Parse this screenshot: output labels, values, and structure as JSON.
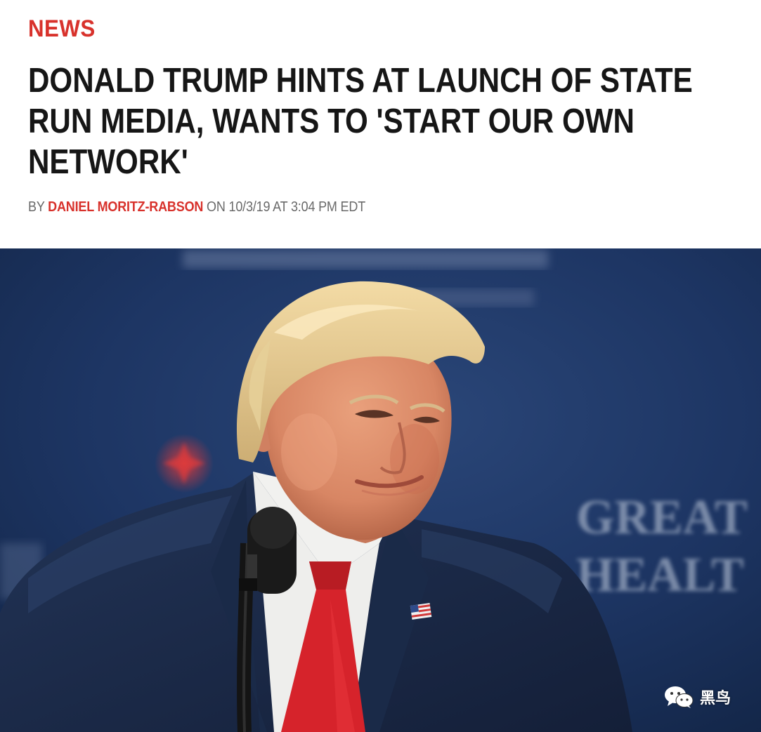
{
  "article": {
    "section": "NEWS",
    "headline_lines": [
      "DONALD TRUMP HINTS AT LAUNCH OF STATE",
      "RUN MEDIA, WANTS TO 'START OUR OWN",
      "NETWORK'"
    ],
    "byline": {
      "prefix": "BY",
      "author": "DANIEL MORITZ-RABSON",
      "middle": "ON",
      "date": "10/3/19",
      "at": "AT",
      "time": "3:04 PM EDT"
    }
  },
  "photo": {
    "backdrop_text_lines": [
      "GREAT",
      "HEALT"
    ]
  },
  "watermark": {
    "icon": "wechat-icon",
    "text": "黑鸟"
  },
  "colors": {
    "accent": "#d8322c",
    "headline": "#161616",
    "byline": "#6a6a6a",
    "backdrop": "#1d3563"
  }
}
